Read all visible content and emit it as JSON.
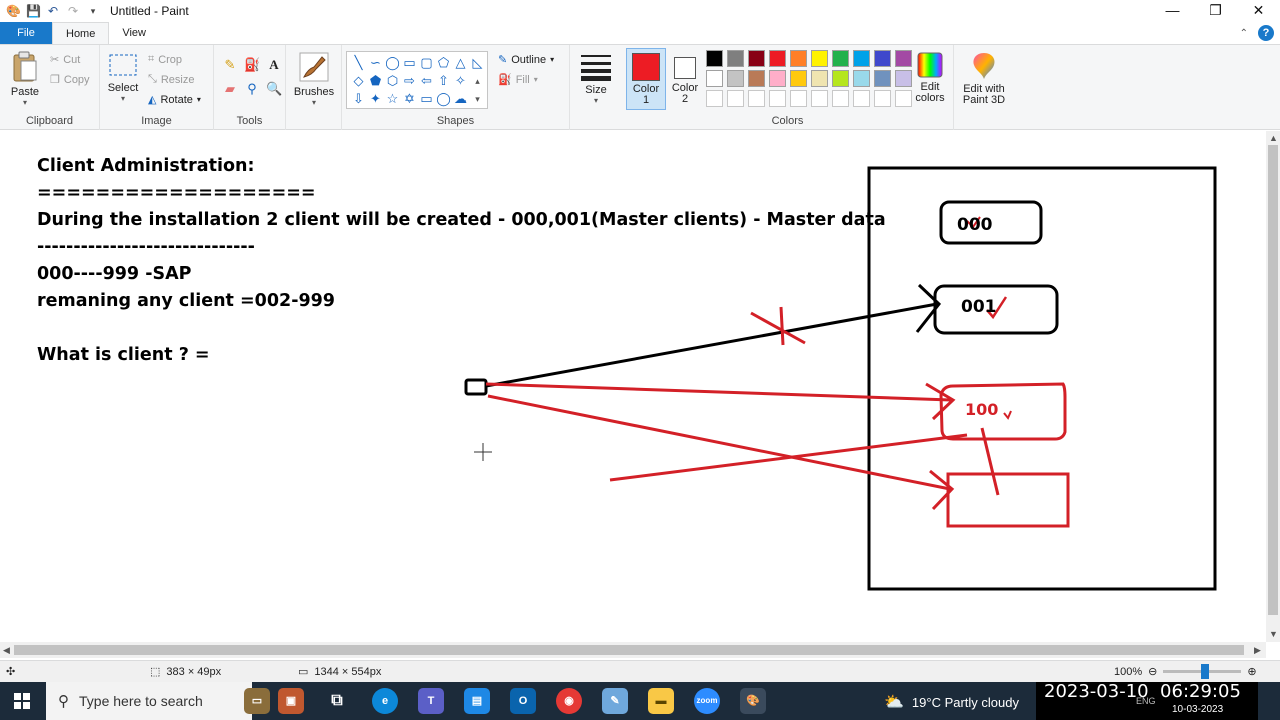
{
  "window": {
    "title": "Untitled - Paint",
    "min_glyph": "—",
    "max_glyph": "❐",
    "close_glyph": "✕"
  },
  "tabs": {
    "file": "File",
    "home": "Home",
    "view": "View",
    "help_glyph": "?"
  },
  "ribbon": {
    "clipboard": {
      "label": "Clipboard",
      "paste": "Paste",
      "cut": "Cut",
      "copy": "Copy"
    },
    "image": {
      "label": "Image",
      "select": "Select",
      "crop": "Crop",
      "resize": "Resize",
      "rotate": "Rotate"
    },
    "tools": {
      "label": "Tools"
    },
    "brushes": {
      "label": "Brushes"
    },
    "shapes": {
      "label": "Shapes",
      "outline": "Outline",
      "fill": "Fill"
    },
    "size": {
      "label": "Size"
    },
    "colors": {
      "label": "Colors",
      "color1_label": "Color 1",
      "color2_label": "Color 2",
      "color1": "#ed1c24",
      "color2": "#ffffff",
      "edit_colors": "Edit colors",
      "palette_row1": [
        "#000000",
        "#7f7f7f",
        "#880015",
        "#ed1c24",
        "#ff7f27",
        "#fff200",
        "#22b14c",
        "#00a2e8",
        "#3f48cc",
        "#a349a4"
      ],
      "palette_row2": [
        "#ffffff",
        "#c3c3c3",
        "#b97a57",
        "#ffaec9",
        "#ffc90e",
        "#efe4b0",
        "#b5e61d",
        "#99d9ea",
        "#7092be",
        "#c8bfe7"
      ]
    },
    "paint3d": "Edit with Paint 3D"
  },
  "canvas": {
    "lines": [
      "Client Administration:",
      "===================",
      "During the installation 2 client will be created - 000,001(Master clients) - Master data",
      "------------------------------",
      "000----999 -SAP",
      "remaning any client =002-999",
      "What is client ? ="
    ],
    "box_labels": [
      "000",
      "001",
      "100"
    ]
  },
  "status": {
    "selection_size": "383 × 49px",
    "canvas_size": "1344 × 554px",
    "zoom": "100%"
  },
  "taskbar": {
    "search_placeholder": "Type here to search",
    "weather": "19°C  Partly cloudy",
    "lang": "ENG",
    "date_small": "10-03-2023",
    "timestamp": "2023-03-10  06:29:05"
  }
}
